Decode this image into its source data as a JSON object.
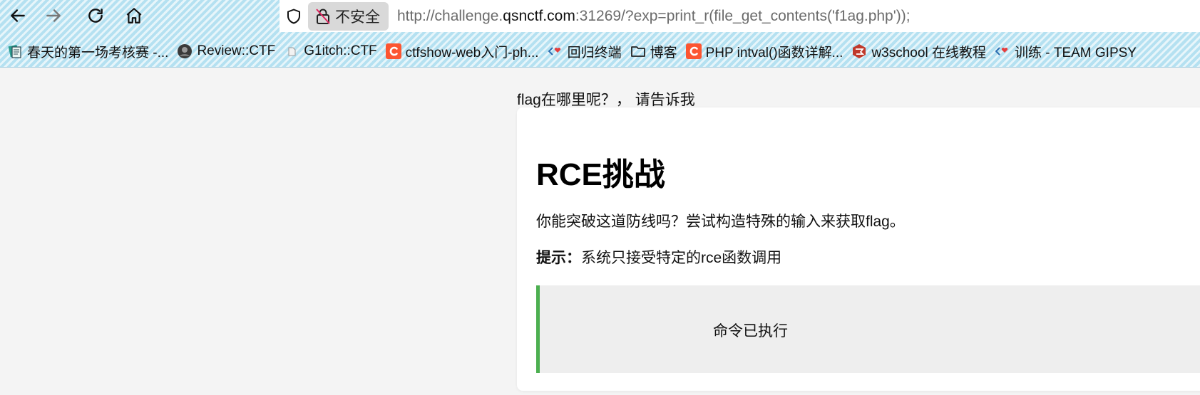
{
  "browser": {
    "security_label": "不安全",
    "url_prefix": "http://challenge.",
    "url_host": "qsnctf.com",
    "url_rest": ":31269/?exp=print_r(file_get_contents('f1ag.php'));"
  },
  "bookmarks": [
    {
      "label": "春天的第一场考核赛 -...",
      "icon": "book-icon"
    },
    {
      "label": "Review::CTF",
      "icon": "avatar-icon"
    },
    {
      "label": "G1itch::CTF",
      "icon": "page-icon"
    },
    {
      "label": "ctfshow-web入门-ph...",
      "icon": "csdn-c-icon"
    },
    {
      "label": "回归终端",
      "icon": "bracket-heart-icon"
    },
    {
      "label": "博客",
      "icon": "folder-icon"
    },
    {
      "label": "PHP intval()函数详解...",
      "icon": "csdn-c-icon"
    },
    {
      "label": "w3school 在线教程",
      "icon": "w3school-icon"
    },
    {
      "label": "训练 - TEAM GIPSY",
      "icon": "bracket-heart-icon"
    }
  ],
  "page": {
    "top_text": "flag在哪里呢？， 请告诉我",
    "title": "RCE挑战",
    "description": "你能突破这道防线吗？尝试构造特殊的输入来获取flag。",
    "hint_label": "提示：",
    "hint_text": "系统只接受特定的rce函数调用",
    "result": "命令已执行"
  },
  "colors": {
    "accent_border": "#4caf50",
    "result_bg": "#eeeeee",
    "page_bg": "#f4f4f4",
    "csdn_red": "#fc5531"
  }
}
